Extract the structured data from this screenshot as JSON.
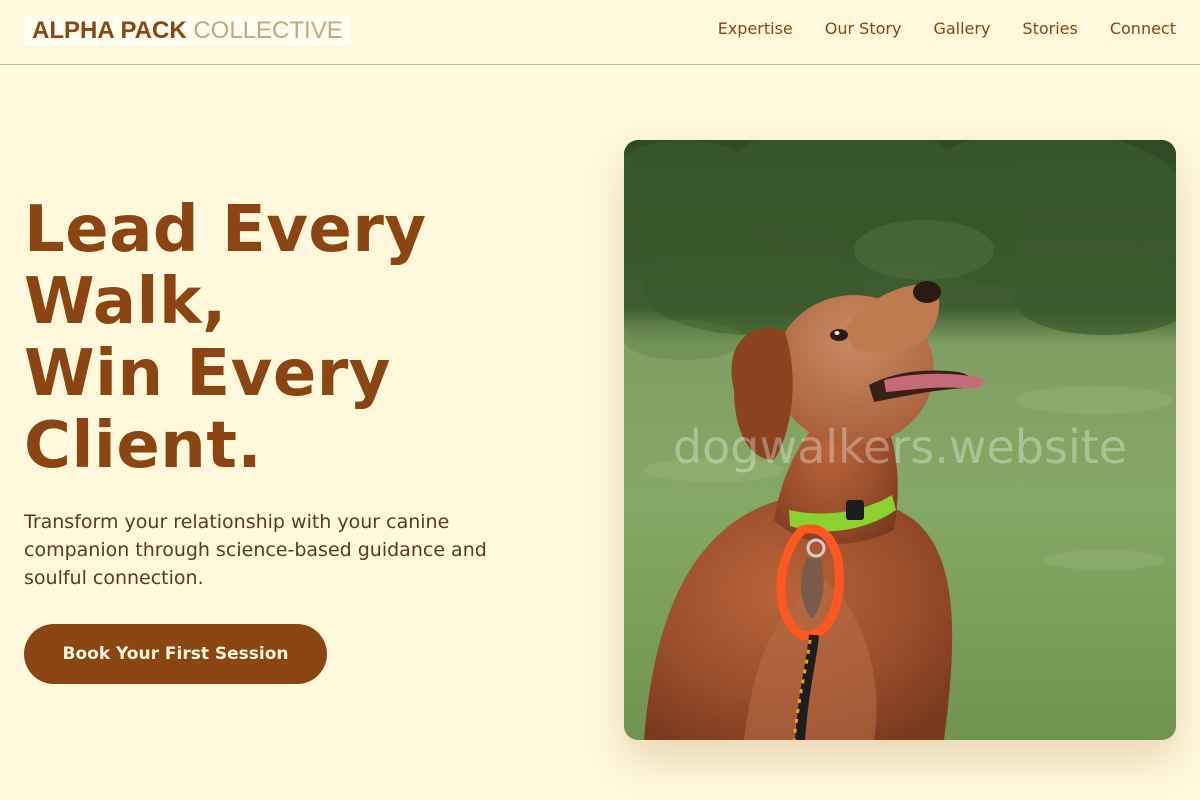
{
  "brand": {
    "name_strong": "ALPHA PACK",
    "name_light": "COLLECTIVE"
  },
  "nav": {
    "items": [
      {
        "label": "Expertise"
      },
      {
        "label": "Our Story"
      },
      {
        "label": "Gallery"
      },
      {
        "label": "Stories"
      },
      {
        "label": "Connect"
      }
    ]
  },
  "hero": {
    "title_lines": [
      "Lead Every",
      "Walk,",
      "Win Every",
      "Client."
    ],
    "subtitle": "Transform your relationship with your canine companion through science-based guidance and soulful connection.",
    "cta_label": "Book Your First Session"
  },
  "photo": {
    "watermark": "dogwalkers.website"
  },
  "colors": {
    "background": "#fff8dc",
    "accent": "#8b4513",
    "logo_light": "#c4a882"
  }
}
